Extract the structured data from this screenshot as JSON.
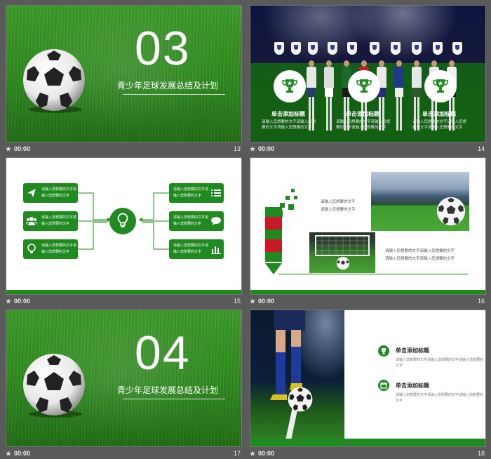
{
  "colors": {
    "accent": "#1f8a1f",
    "background": "#5a5a5a"
  },
  "slides": [
    {
      "number": "13",
      "time": "00:00",
      "section_number": "03",
      "section_title": "青少年足球发展总结及计划"
    },
    {
      "number": "14",
      "time": "00:00",
      "cards": [
        {
          "title": "单击添加标题",
          "text": "请输入您想要的文字请输入您想要的文字请输入您想要的文字"
        },
        {
          "title": "单击添加标题",
          "text": "请输入您想要的文字请输入您想要的文字请输入您想要的文字"
        },
        {
          "title": "单击添加标题",
          "text": "请输入您想要的文字请输入您想要的文字请输入您想要的文字"
        }
      ]
    },
    {
      "number": "15",
      "time": "00:00",
      "left_boxes": [
        {
          "icon": "paper-plane-icon",
          "line1": "请输入您想要的文字请",
          "line2": "输入您想要的文字"
        },
        {
          "icon": "people-icon",
          "line1": "请输入您想要的文字请",
          "line2": "输入您想要的文字"
        },
        {
          "icon": "lightbulb-icon",
          "line1": "请输入您想要的文字请",
          "line2": "输入您想要的文字"
        }
      ],
      "right_boxes": [
        {
          "icon": "list-icon",
          "line1": "请输入您想要的文字请",
          "line2": "输入您想要的文字"
        },
        {
          "icon": "chat-icon",
          "line1": "请输入您想要的文字请",
          "line2": "输入您想要的文字"
        },
        {
          "icon": "bar-chart-icon",
          "line1": "请输入您想要的文字请",
          "line2": "输入您想要的文字"
        }
      ]
    },
    {
      "number": "16",
      "time": "00:00",
      "text_top_1": "请输入您想要的文字",
      "text_top_2": "请输入您想要的文字",
      "text_bottom_1": "请输入您想要的文字请输入您想要的文字",
      "text_bottom_2": "请输入您想要的文字请输入您想要的文字"
    },
    {
      "number": "17",
      "time": "00:00",
      "section_number": "04",
      "section_title": "青少年足球发展总结及计划"
    },
    {
      "number": "18",
      "time": "00:00",
      "items": [
        {
          "title": "单击添加标题",
          "text": "请输入您想要的文字请输入您想要的文字请输入您想要的文字"
        },
        {
          "title": "单击添加标题",
          "text": "请输入您想要的文字请输入您想要的文字请输入您想要的文字"
        }
      ]
    }
  ]
}
